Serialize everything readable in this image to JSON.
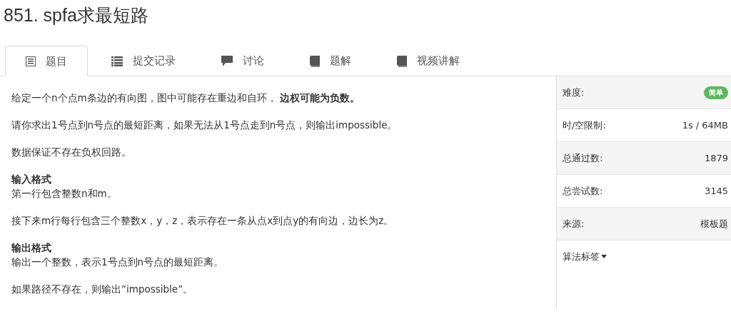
{
  "title": "851. spfa求最短路",
  "tabs": [
    {
      "label": "题目",
      "kind": "doc",
      "selected": true
    },
    {
      "label": "提交记录",
      "kind": "list",
      "selected": false
    },
    {
      "label": "讨论",
      "kind": "comment",
      "selected": false
    },
    {
      "label": "题解",
      "kind": "book",
      "selected": false
    },
    {
      "label": "视频讲解",
      "kind": "book",
      "selected": false
    }
  ],
  "content": [
    {
      "kind": "paragraph",
      "text": "给定一个n个点m条边的有向图，图中可能存在重边和自环， **边权可能为负数。**"
    },
    {
      "kind": "paragraph",
      "text": "请你求出1号点到n号点的最短距离，如果无法从1号点走到n号点，则输出impossible。"
    },
    {
      "kind": "paragraph",
      "text": "数据保证不存在负权回路。"
    },
    {
      "kind": "heading",
      "text": "输入格式"
    },
    {
      "kind": "paragraph",
      "text": "第一行包含整数n和m。"
    },
    {
      "kind": "paragraph",
      "text": "接下来m行每行包含三个整数x，y，z，表示存在一条从点x到点y的有向边，边长为z。"
    },
    {
      "kind": "heading",
      "text": "输出格式"
    },
    {
      "kind": "paragraph",
      "text": "输出一个整数，表示1号点到n号点的最短距离。"
    },
    {
      "kind": "paragraph",
      "text": "如果路径不存在，则输出”impossible”。"
    }
  ],
  "info": [
    {
      "label": "难度:",
      "kind": "badge",
      "value": "简单",
      "color": "#5cb85c"
    },
    {
      "label": "时/空限制:",
      "kind": "text",
      "value": "1s / 64MB"
    },
    {
      "label": "总通过数:",
      "kind": "text",
      "value": "1879"
    },
    {
      "label": "总尝试数:",
      "kind": "text",
      "value": "3145"
    },
    {
      "label": "来源:",
      "kind": "text",
      "value": "模板题"
    },
    {
      "label": "算法标签",
      "kind": "dropdown"
    }
  ]
}
